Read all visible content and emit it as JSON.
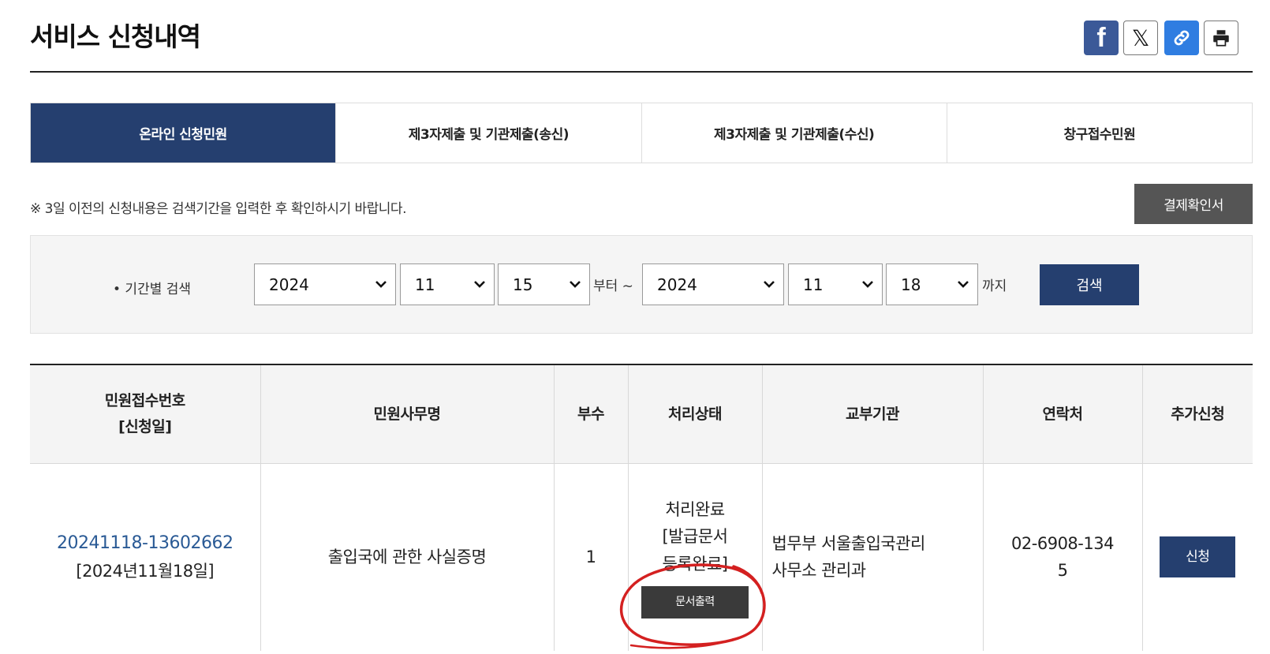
{
  "page": {
    "title": "서비스 신청내역",
    "share_icons": [
      "facebook-icon",
      "x-icon",
      "link-icon",
      "print-icon"
    ]
  },
  "tabs": [
    {
      "label": "온라인 신청민원",
      "active": true
    },
    {
      "label": "제3자제출 및 기관제출(송신)",
      "active": false
    },
    {
      "label": "제3자제출 및 기관제출(수신)",
      "active": false
    },
    {
      "label": "창구접수민원",
      "active": false
    }
  ],
  "notice": "※ 3일 이전의 신청내용은 검색기간을 입력한 후 확인하시기 바랍니다.",
  "payment_button": "결제확인서",
  "search": {
    "label": "• 기간별 검색",
    "from_year": "2024",
    "from_month": "11",
    "from_day": "15",
    "from_suffix": "부터 ~",
    "to_year": "2024",
    "to_month": "11",
    "to_day": "18",
    "to_suffix": "까지",
    "button": "검색"
  },
  "table": {
    "headers": {
      "receipt_line1": "민원접수번호",
      "receipt_line2": "[신청일]",
      "service": "민원사무명",
      "copies": "부수",
      "status": "처리상태",
      "agency": "교부기관",
      "contact": "연락처",
      "additional": "추가신청"
    },
    "rows": [
      {
        "receipt_no": "20241118-13602662",
        "date": "[2024년11월18일]",
        "service": "출입국에 관한 사실증명",
        "copies": "1",
        "status_line1": "처리완료",
        "status_line2": "[발급문서",
        "status_line3": "등록완료]",
        "print_button": "문서출력",
        "agency_line1": "법무부 서울출입국관리",
        "agency_line2": "사무소 관리과",
        "contact_line1": "02-6908-134",
        "contact_line2": "5",
        "apply_button": "신청"
      }
    ]
  },
  "colors": {
    "accent": "#253f6f",
    "annotation": "#d42020",
    "dark_button": "#3a3a3a"
  }
}
